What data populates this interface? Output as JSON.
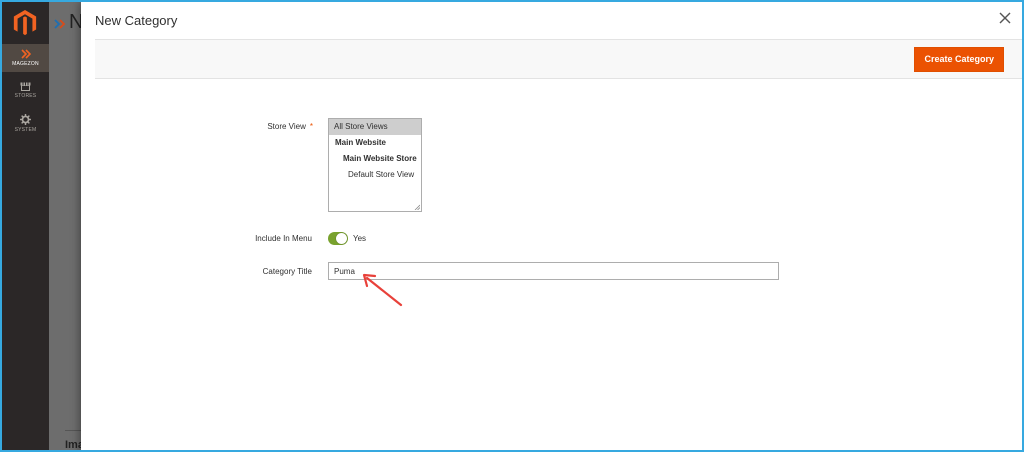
{
  "sidebar": {
    "items": [
      {
        "label": "MAGEZON",
        "icon": "chevron-double-right-icon",
        "active": true
      },
      {
        "label": "STORES",
        "icon": "store-icon",
        "active": false
      },
      {
        "label": "SYSTEM",
        "icon": "gear-icon",
        "active": false
      }
    ]
  },
  "background_page": {
    "title": "N",
    "bottom_text": "Ima"
  },
  "modal": {
    "title": "New Category",
    "primary_button": "Create Category",
    "fields": {
      "store_view": {
        "label": "Store View",
        "required": "*",
        "options": [
          "All Store Views",
          "Main Website",
          "Main Website Store",
          "Default Store View"
        ],
        "selected": "All Store Views"
      },
      "include_in_menu": {
        "label": "Include In Menu",
        "value_label": "Yes"
      },
      "category_title": {
        "label": "Category Title",
        "value": "Puma"
      }
    }
  },
  "colors": {
    "accent": "#eb5202",
    "toggle_on": "#79a22e",
    "sidebar_bg": "#2b2727",
    "frame_border": "#36a9e0"
  }
}
